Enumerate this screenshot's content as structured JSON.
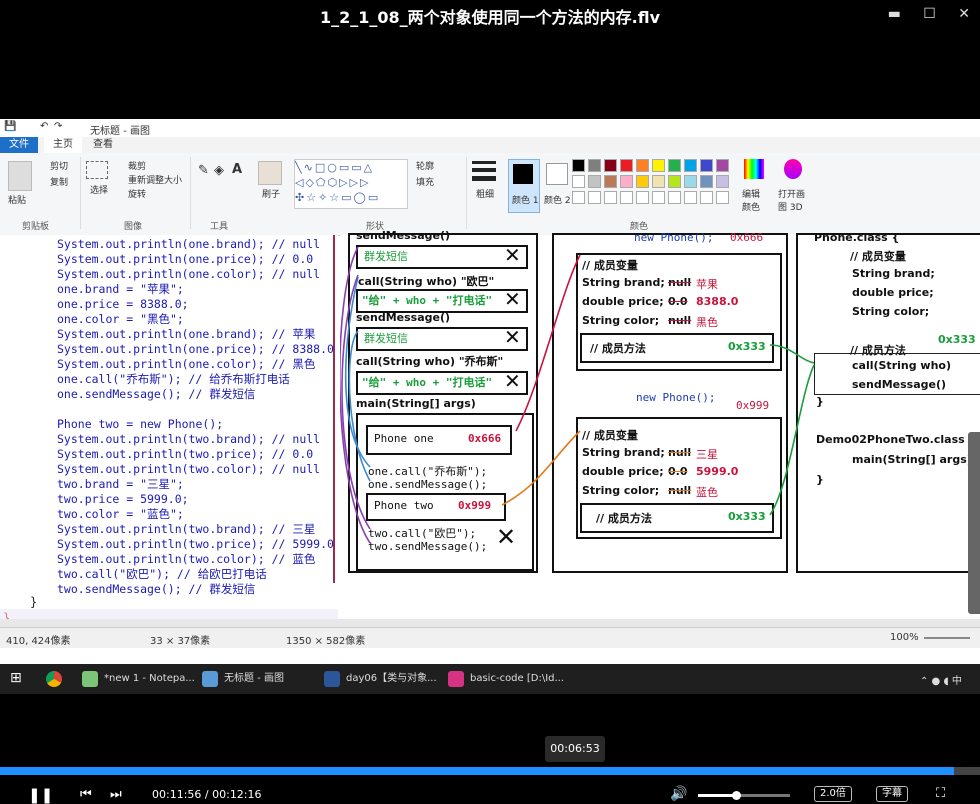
{
  "video": {
    "title": "1_2_1_08_两个对象使用同一个方法的内存.flv",
    "tooltip_time": "00:06:53",
    "current_time": "00:11:56",
    "duration": "00:12:16",
    "progress_fraction": 0.973,
    "speed_label": "2.0倍",
    "subtitle_label": "字幕",
    "accent_color": "#1e90ff"
  },
  "paint": {
    "window_title": "无标题 - 画图",
    "tabs": [
      "文件",
      "主页",
      "查看"
    ],
    "ribbon": {
      "paste": "粘贴",
      "cut": "剪切",
      "copy": "复制",
      "clipboard": "剪贴板",
      "crop": "裁剪",
      "resize": "重新调整大小",
      "rotate": "旋转",
      "select": "选择",
      "image": "图像",
      "tools": "工具",
      "brush": "刷子",
      "shapes": "形状",
      "outline": "轮廓",
      "fill": "填充",
      "size": "粗细",
      "color1": "颜色 1",
      "color2": "颜色 2",
      "colors": "颜色",
      "edit_colors": "编辑颜色",
      "paint3d": "打开画图 3D"
    },
    "status": {
      "cursor": "410, 424像素",
      "selection": "33 × 37像素",
      "canvas": "1350 × 582像素",
      "zoom": "100%"
    }
  },
  "code_lines": [
    {
      "t": "System.out.println(one.brand); // null"
    },
    {
      "t": "System.out.println(one.price); // 0.0"
    },
    {
      "t": "System.out.println(one.color); // null"
    },
    {
      "t": "one.brand = \"苹果\";"
    },
    {
      "t": "one.price = 8388.0;"
    },
    {
      "t": "one.color = \"黑色\";"
    },
    {
      "t": "System.out.println(one.brand); // 苹果"
    },
    {
      "t": "System.out.println(one.price); // 8388.0"
    },
    {
      "t": "System.out.println(one.color); // 黑色"
    },
    {
      "t": "one.call(\"乔布斯\"); // 给乔布斯打电话"
    },
    {
      "t": "one.sendMessage(); // 群发短信"
    },
    {
      "t": ""
    },
    {
      "t": "Phone two = new Phone();"
    },
    {
      "t": "System.out.println(two.brand); // null"
    },
    {
      "t": "System.out.println(two.price); // 0.0"
    },
    {
      "t": "System.out.println(two.color); // null"
    },
    {
      "t": "two.brand = \"三星\";"
    },
    {
      "t": "two.price = 5999.0;"
    },
    {
      "t": "two.color = \"蓝色\";"
    },
    {
      "t": "System.out.println(two.brand); // 三星"
    },
    {
      "t": "System.out.println(two.price); // 5999.0"
    },
    {
      "t": "System.out.println(two.color); // 蓝色"
    },
    {
      "t": "two.call(\"欧巴\"); // 给欧巴打电话"
    },
    {
      "t": "two.sendMessage(); // 群发短信"
    }
  ],
  "closing_brace": "}",
  "closing_brace_red": "}",
  "stack": {
    "send_top": "sendMessage()",
    "group_sms_1": "群发短信",
    "call_oba": "call(String who) \"欧巴\"",
    "give_oba": "\"给\" + who + \"打电话\"",
    "send_mid": "sendMessage()",
    "group_sms_2": "群发短信",
    "call_jobs": "call(String who) \"乔布斯\"",
    "give_jobs": "\"给\" + who + \"打电话\"",
    "main": "main(String[] args)",
    "phone_one": "Phone one",
    "phone_one_addr": "0x666",
    "one_call": "one.call(\"乔布斯\");",
    "one_send": "one.sendMessage();",
    "phone_two": "Phone two",
    "phone_two_addr": "0x999",
    "two_call": "two.call(\"欧巴\");",
    "two_send": "two.sendMessage();"
  },
  "heap": {
    "obj1_header": "new Phone();",
    "obj1_addr": "0x666",
    "members": "// 成员变量",
    "brand": "String brand;",
    "price": "double price;",
    "color": "String color;",
    "null": "null",
    "zero": "0.0",
    "obj1_brand": "苹果",
    "obj1_price": "8388.0",
    "obj1_color": "黑色",
    "methods": "// 成员方法",
    "method_addr": "0x333",
    "obj2_header": "new Phone();",
    "obj2_addr": "0x999",
    "obj2_brand": "三星",
    "obj2_price": "5999.0",
    "obj2_color": "蓝色"
  },
  "method_area": {
    "class1": "Phone.class {",
    "members": "// 成员变量",
    "brand": "String brand;",
    "price": "double price;",
    "color": "String color;",
    "methods": "// 成员方法",
    "call": "call(String who)",
    "send": "sendMessage()",
    "close1": "}",
    "class2": "Demo02PhoneTwo.class {",
    "main": "main(String[] args)",
    "close2": "}",
    "addr": "0x333"
  },
  "taskbar": [
    {
      "label": "*new 1 - Notepa...",
      "color": "#7cc576"
    },
    {
      "label": "无标题 - 画图",
      "color": "#5b9bd5"
    },
    {
      "label": "day06【类与对象...",
      "color": "#2b579a"
    },
    {
      "label": "basic-code [D:\\Id...",
      "color": "#d63384"
    }
  ]
}
